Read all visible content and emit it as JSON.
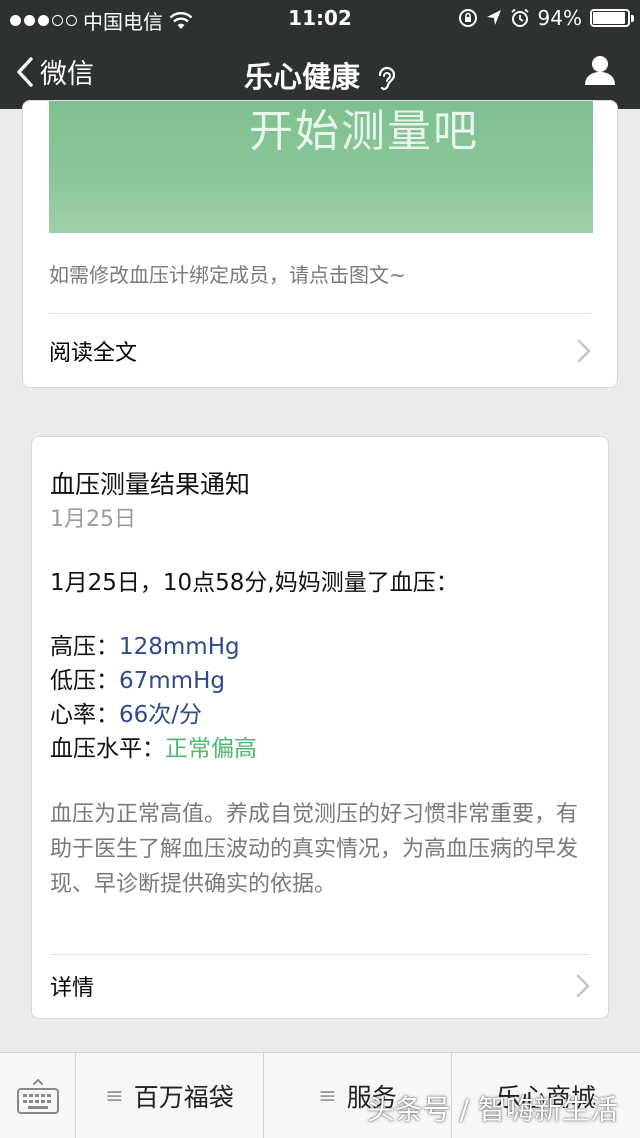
{
  "status_bar": {
    "carrier": "中国电信",
    "time": "11:02",
    "battery": "94%",
    "battery_level": 0.94
  },
  "nav": {
    "back_label": "微信",
    "title": "乐心健康"
  },
  "card_article": {
    "banner_text": "开始测量吧",
    "note": "如需修改血压计绑定成员，请点击图文~",
    "read_more": "阅读全文"
  },
  "card_notice": {
    "title": "血压测量结果通知",
    "date": "1月25日",
    "intro": "1月25日，10点58分,妈妈测量了血压：",
    "rows": [
      {
        "label": "高压：",
        "value": "128mmHg"
      },
      {
        "label": "低压：",
        "value": "67mmHg"
      },
      {
        "label": "心率：",
        "value": "66次/分"
      },
      {
        "label": "血压水平：",
        "value": "正常偏高"
      }
    ],
    "description": "血压为正常高值。养成自觉测压的好习惯非常重要，有助于医生了解血压波动的真实情况，为高血压病的早发现、早诊断提供确实的依据。",
    "detail": "详情"
  },
  "menu": {
    "items": [
      {
        "label": "百万福袋"
      },
      {
        "label": "服务"
      },
      {
        "label": "乐心商城"
      }
    ]
  },
  "watermark": "头条号 / 智嗨新生活",
  "colors": {
    "nav_bg": "#2e3132",
    "value_blue": "#2f4a8a",
    "value_green": "#4cbb6e",
    "banner_green": "#8cc79b"
  }
}
